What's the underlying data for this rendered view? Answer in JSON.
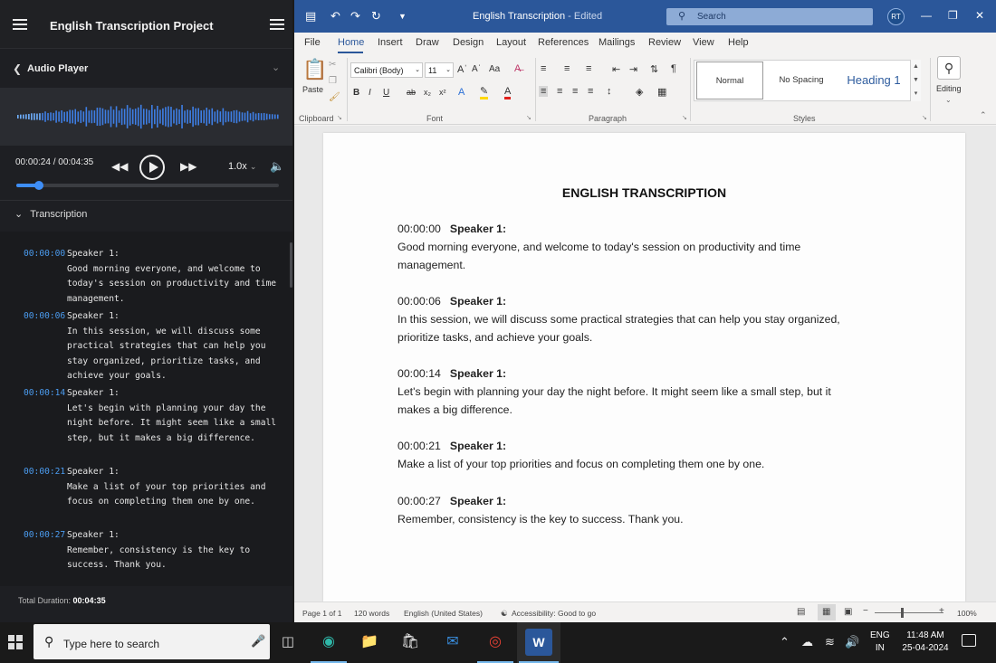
{
  "left_app": {
    "title": "English Transcription Project",
    "audio_player": {
      "title": "Audio Player",
      "current_time": "00:00:24 / 00:04:35",
      "speed": "1.0x",
      "progress": 0.087
    },
    "transcription_header": "Transcription",
    "items": [
      {
        "ts": "00:00:00",
        "speaker": "Speaker 1:",
        "text": "Good morning everyone, and welcome to today's session on productivity and time management."
      },
      {
        "ts": "00:00:06",
        "speaker": "Speaker 1:",
        "text": "In this session, we will discuss some practical strategies that can help you stay organized, prioritize tasks, and achieve your goals."
      },
      {
        "ts": "00:00:14",
        "speaker": "Speaker 1:",
        "text": "Let's begin with planning your day the night before. It might seem like a small step, but it makes a big difference."
      },
      {
        "ts": "00:00:21",
        "speaker": "Speaker 1:",
        "text": "Make a list of your top priorities and focus on completing them one by one."
      },
      {
        "ts": "00:00:27",
        "speaker": "Speaker 1:",
        "text": "Remember, consistency is the key to success. Thank you."
      }
    ],
    "total_label": "Total Duration:",
    "total_value": "00:04:35"
  },
  "word": {
    "doc_title": "English Transcription",
    "doc_status": "- Edited",
    "search_placeholder": "Search",
    "avatar": "RT",
    "menu": [
      "File",
      "Home",
      "Insert",
      "Draw",
      "Design",
      "Layout",
      "References",
      "Mailings",
      "Review",
      "View",
      "Help"
    ],
    "ribbon": {
      "paste": "Paste",
      "clipboard": "Clipboard",
      "font_name": "Calibri (Body)",
      "font_size": "11",
      "font": "Font",
      "paragraph": "Paragraph",
      "styles_label": "Styles",
      "styles": [
        "Normal",
        "No Spacing",
        "Heading 1"
      ],
      "editing": "Editing"
    },
    "document": {
      "heading": "ENGLISH TRANSCRIPTION",
      "entries": [
        {
          "ts": "00:00:00",
          "speaker": "Speaker 1:",
          "text": "Good morning everyone, and welcome to today's session on productivity and time management."
        },
        {
          "ts": "00:00:06",
          "speaker": "Speaker 1:",
          "text": "In this session, we will discuss some practical strategies that can help you stay organized, prioritize tasks, and achieve your goals."
        },
        {
          "ts": "00:00:14",
          "speaker": "Speaker 1:",
          "text": "Let's begin with planning your day the night before. It might seem like a small step, but it makes a big difference."
        },
        {
          "ts": "00:00:21",
          "speaker": "Speaker 1:",
          "text": "Make a list of your top priorities and focus on completing them one by one."
        },
        {
          "ts": "00:00:27",
          "speaker": "Speaker 1:",
          "text": "Remember, consistency is the key to success. Thank you."
        }
      ]
    },
    "status": {
      "page": "Page 1 of 1",
      "words": "120 words",
      "language": "English (United States)",
      "accessibility": "Accessibility: Good to go",
      "zoom": "100%"
    }
  },
  "taskbar": {
    "search_placeholder": "Type here to search",
    "lang_top": "ENG",
    "lang_bottom": "IN",
    "time": "11:48 AM",
    "date": "25-04-2024"
  },
  "colors": {
    "word_blue": "#2b579a",
    "timestamp_blue": "#4b9cf0",
    "progress_blue": "#3e8ef7"
  }
}
